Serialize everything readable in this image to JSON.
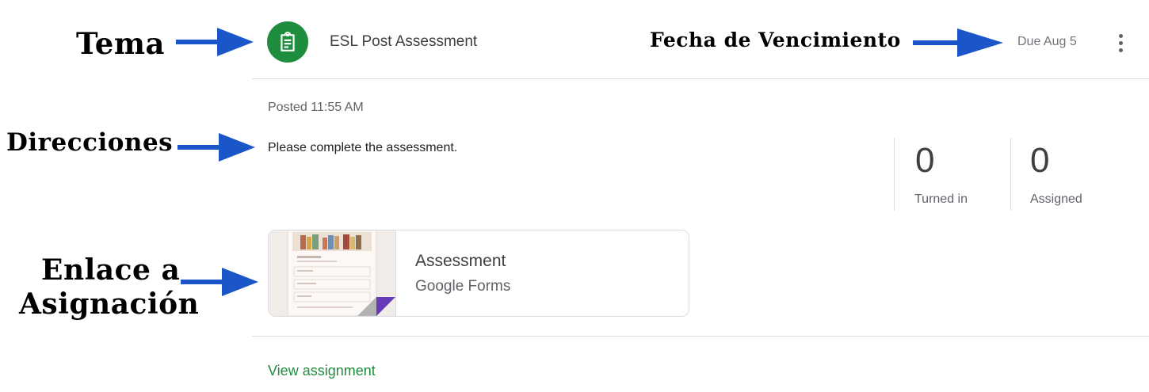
{
  "annotations": {
    "topic": "Tema",
    "due_date": "Fecha de Vencimiento",
    "directions": "Direcciones",
    "link_line1": "Enlace a",
    "link_line2": "Asignación"
  },
  "header": {
    "icon": "assignment-icon",
    "title": "ESL Post Assessment",
    "due": "Due Aug 5",
    "more_icon": "more-vert-icon"
  },
  "post": {
    "posted": "Posted 11:55 AM",
    "instructions": "Please complete the assessment."
  },
  "stats": {
    "turned_in_value": "0",
    "turned_in_label": "Turned in",
    "assigned_value": "0",
    "assigned_label": "Assigned"
  },
  "attachment": {
    "title": "Assessment",
    "type": "Google Forms"
  },
  "footer": {
    "view_link": "View assignment"
  },
  "colors": {
    "accent_green": "#1e8e3e",
    "arrow_blue": "#1a56c8",
    "forms_purple": "#673ab7"
  }
}
